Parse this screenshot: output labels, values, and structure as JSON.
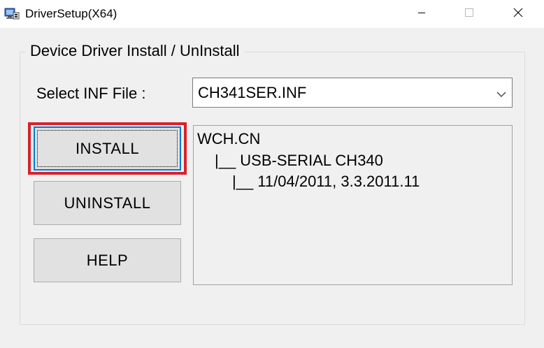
{
  "window": {
    "title": "DriverSetup(X64)",
    "icon": "driver-setup-app-icon",
    "controls": {
      "minimize": "minimize-icon",
      "maximize": "maximize-icon",
      "close": "close-icon"
    }
  },
  "group": {
    "legend": "Device Driver Install / UnInstall"
  },
  "inf": {
    "label": "Select INF File :",
    "selected": "CH341SER.INF",
    "dropdown_icon": "chevron-down-icon"
  },
  "buttons": {
    "install": "INSTALL",
    "uninstall": "UNINSTALL",
    "help": "HELP"
  },
  "info": {
    "line1": "WCH.CN",
    "line2": "|__ USB-SERIAL CH340",
    "line3": "|__ 11/04/2011, 3.3.2011.11"
  },
  "colors": {
    "highlight": "#d9212b",
    "focus": "#0078d7",
    "window_bg": "#f0f0f0"
  }
}
